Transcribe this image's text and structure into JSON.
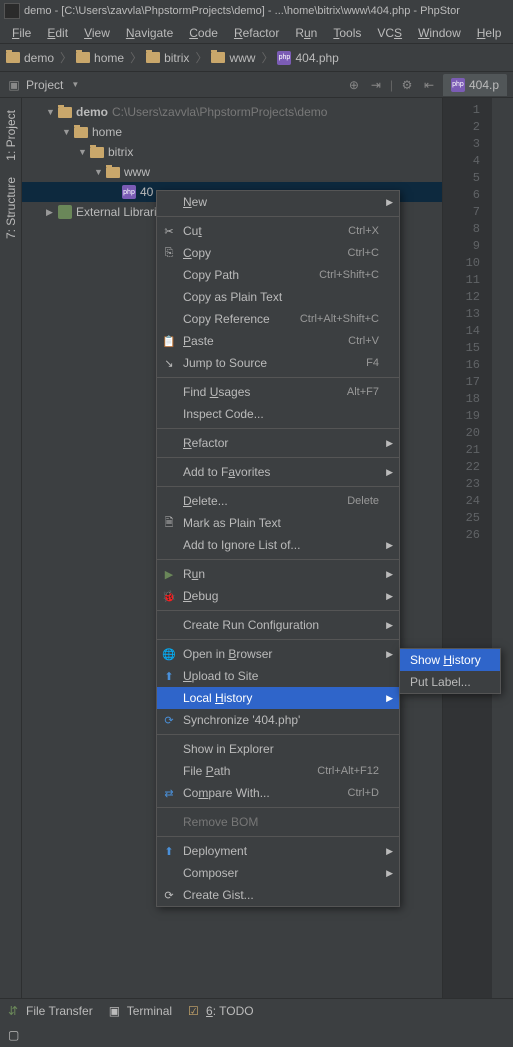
{
  "titlebar": {
    "text": "demo - [C:\\Users\\zavvla\\PhpstormProjects\\demo] - ...\\home\\bitrix\\www\\404.php - PhpStor"
  },
  "menubar": {
    "file": "File",
    "edit": "Edit",
    "view": "View",
    "navigate": "Navigate",
    "code": "Code",
    "refactor": "Refactor",
    "run": "Run",
    "tools": "Tools",
    "vcs": "VCS",
    "window": "Window",
    "help": "Help"
  },
  "breadcrumbs": {
    "b0": "demo",
    "b1": "home",
    "b2": "bitrix",
    "b3": "www",
    "b4": "404.php"
  },
  "toolbar": {
    "project": "Project",
    "editor_tab": "404.p"
  },
  "sidetabs": {
    "project": "1: Project",
    "structure": "7: Structure"
  },
  "tree": {
    "root": "demo",
    "root_path": "C:\\Users\\zavvla\\PhpstormProjects\\demo",
    "home": "home",
    "bitrix": "bitrix",
    "www": "www",
    "file": "40",
    "ext": "External Libraries"
  },
  "gutter": {
    "lines": [
      "1",
      "2",
      "3",
      "4",
      "5",
      "6",
      "7",
      "8",
      "9",
      "10",
      "11",
      "12",
      "13",
      "14",
      "15",
      "16",
      "17",
      "18",
      "19",
      "20",
      "21",
      "22",
      "23",
      "24",
      "25",
      "26"
    ]
  },
  "context": {
    "new": "New",
    "cut": "Cut",
    "cut_sc": "Ctrl+X",
    "copy": "Copy",
    "copy_sc": "Ctrl+C",
    "copy_path": "Copy Path",
    "copy_path_sc": "Ctrl+Shift+C",
    "copy_plain": "Copy as Plain Text",
    "copy_ref": "Copy Reference",
    "copy_ref_sc": "Ctrl+Alt+Shift+C",
    "paste": "Paste",
    "paste_sc": "Ctrl+V",
    "jump": "Jump to Source",
    "jump_sc": "F4",
    "find_usages": "Find Usages",
    "find_usages_sc": "Alt+F7",
    "inspect": "Inspect Code...",
    "refactor": "Refactor",
    "favorites": "Add to Favorites",
    "delete": "Delete...",
    "delete_sc": "Delete",
    "mark_plain": "Mark as Plain Text",
    "ignore": "Add to Ignore List of...",
    "run": "Run",
    "debug": "Debug",
    "create_run": "Create Run Configuration",
    "open_browser": "Open in Browser",
    "upload": "Upload to Site",
    "local_history": "Local History",
    "sync": "Synchronize '404.php'",
    "show_explorer": "Show in Explorer",
    "file_path": "File Path",
    "file_path_sc": "Ctrl+Alt+F12",
    "compare": "Compare With...",
    "compare_sc": "Ctrl+D",
    "remove_bom": "Remove BOM",
    "deployment": "Deployment",
    "composer": "Composer",
    "gist": "Create Gist..."
  },
  "submenu": {
    "show_history": "Show History",
    "put_label": "Put Label..."
  },
  "status": {
    "filetransfer": "File Transfer",
    "terminal": "Terminal",
    "todo": "6: TODO"
  }
}
